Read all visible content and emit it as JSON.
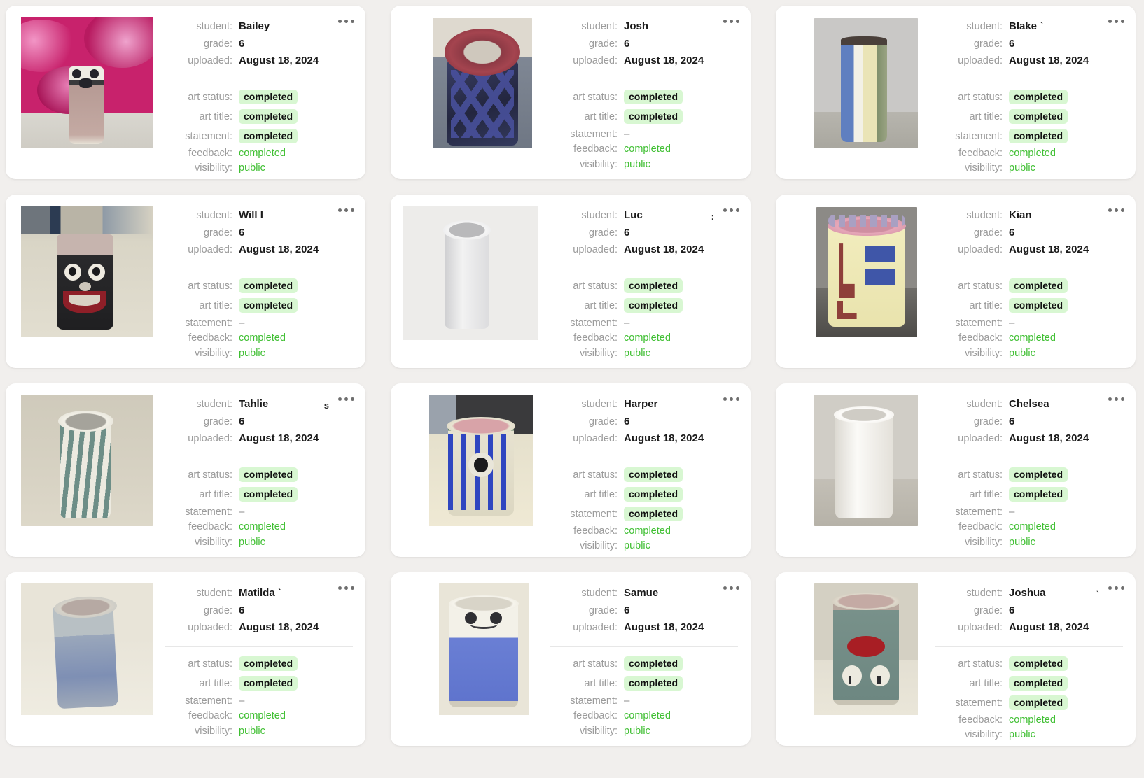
{
  "labels": {
    "student": "student:",
    "grade": "grade:",
    "uploaded": "uploaded:",
    "art_status": "art status:",
    "art_title": "art title:",
    "statement": "statement:",
    "feedback": "feedback:",
    "visibility": "visibility:"
  },
  "colors": {
    "page_background": "#f1efed",
    "card_background": "#ffffff",
    "label_gray": "#9b9b9b",
    "value_black": "#1b1b1b",
    "badge_background": "#d8f7d2",
    "green_text": "#3fbf32",
    "divider": "#e7e7e7"
  },
  "icons": {
    "kebab": "more-options-icon"
  },
  "cards": [
    {
      "student": "Bailey",
      "grade": "6",
      "uploaded": "August 18, 2024",
      "art_status": "completed",
      "art_title": "completed",
      "statement": "completed",
      "statement_is_badge": true,
      "feedback": "completed",
      "visibility": "public",
      "name_truncated_mark": ""
    },
    {
      "student": "Josh",
      "grade": "6",
      "uploaded": "August 18, 2024",
      "art_status": "completed",
      "art_title": "completed",
      "statement": "–",
      "statement_is_badge": false,
      "feedback": "completed",
      "visibility": "public",
      "name_truncated_mark": ""
    },
    {
      "student": "Blake ˋ",
      "grade": "6",
      "uploaded": "August 18, 2024",
      "art_status": "completed",
      "art_title": "completed",
      "statement": "completed",
      "statement_is_badge": true,
      "feedback": "completed",
      "visibility": "public",
      "name_truncated_mark": ""
    },
    {
      "student": "Will I",
      "grade": "6",
      "uploaded": "August 18, 2024",
      "art_status": "completed",
      "art_title": "completed",
      "statement": "–",
      "statement_is_badge": false,
      "feedback": "completed",
      "visibility": "public",
      "name_truncated_mark": ""
    },
    {
      "student": "Luc",
      "grade": "6",
      "uploaded": "August 18, 2024",
      "art_status": "completed",
      "art_title": "completed",
      "statement": "–",
      "statement_is_badge": false,
      "feedback": "completed",
      "visibility": "public",
      "name_truncated_mark": ":"
    },
    {
      "student": "Kian",
      "grade": "6",
      "uploaded": "August 18, 2024",
      "art_status": "completed",
      "art_title": "completed",
      "statement": "–",
      "statement_is_badge": false,
      "feedback": "completed",
      "visibility": "public",
      "name_truncated_mark": ""
    },
    {
      "student": "Tahlie",
      "grade": "6",
      "uploaded": "August 18, 2024",
      "art_status": "completed",
      "art_title": "completed",
      "statement": "–",
      "statement_is_badge": false,
      "feedback": "completed",
      "visibility": "public",
      "name_truncated_mark": "s"
    },
    {
      "student": "Harper",
      "grade": "6",
      "uploaded": "August 18, 2024",
      "art_status": "completed",
      "art_title": "completed",
      "statement": "completed",
      "statement_is_badge": true,
      "feedback": "completed",
      "visibility": "public",
      "name_truncated_mark": ""
    },
    {
      "student": "Chelsea",
      "grade": "6",
      "uploaded": "August 18, 2024",
      "art_status": "completed",
      "art_title": "completed",
      "statement": "–",
      "statement_is_badge": false,
      "feedback": "completed",
      "visibility": "public",
      "name_truncated_mark": ""
    },
    {
      "student": "Matilda ˋ",
      "grade": "6",
      "uploaded": "August 18, 2024",
      "art_status": "completed",
      "art_title": "completed",
      "statement": "–",
      "statement_is_badge": false,
      "feedback": "completed",
      "visibility": "public",
      "name_truncated_mark": ""
    },
    {
      "student": "Samue",
      "grade": "6",
      "uploaded": "August 18, 2024",
      "art_status": "completed",
      "art_title": "completed",
      "statement": "–",
      "statement_is_badge": false,
      "feedback": "completed",
      "visibility": "public",
      "name_truncated_mark": ""
    },
    {
      "student": "Joshua",
      "grade": "6",
      "uploaded": "August 18, 2024",
      "art_status": "completed",
      "art_title": "completed",
      "statement": "completed",
      "statement_is_badge": true,
      "feedback": "completed",
      "visibility": "public",
      "name_truncated_mark": "ˋ"
    }
  ]
}
